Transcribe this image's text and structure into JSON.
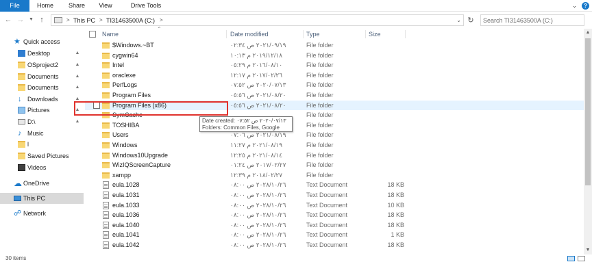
{
  "ribbon": {
    "tabs": [
      {
        "label": "File"
      },
      {
        "label": "Home"
      },
      {
        "label": "Share"
      },
      {
        "label": "View"
      },
      {
        "label": "Drive Tools"
      }
    ],
    "help_label": "?"
  },
  "address": {
    "segments": [
      "This PC",
      "TI31463500A (C:)"
    ],
    "separator": ">"
  },
  "search": {
    "placeholder": "Search TI31463500A (C:)"
  },
  "nav": {
    "items": [
      {
        "label": "Quick access",
        "icon": "star-icon",
        "pinned": false
      },
      {
        "label": "Desktop",
        "icon": "desktop-folder-icon",
        "pinned": true
      },
      {
        "label": "OSproject2",
        "icon": "folder-icon",
        "pinned": true
      },
      {
        "label": "Documents",
        "icon": "documents-folder-icon",
        "pinned": true
      },
      {
        "label": "Documents",
        "icon": "folder-icon",
        "pinned": true
      },
      {
        "label": "Downloads",
        "icon": "download-icon",
        "pinned": true
      },
      {
        "label": "Pictures",
        "icon": "pictures-folder-icon",
        "pinned": true
      },
      {
        "label": "D:\\",
        "icon": "drive-icon",
        "pinned": true
      },
      {
        "label": "Music",
        "icon": "music-icon",
        "pinned": false
      },
      {
        "label": "l",
        "icon": "folder-icon",
        "pinned": false
      },
      {
        "label": "Saved Pictures",
        "icon": "folder-icon",
        "pinned": false
      },
      {
        "label": "Videos",
        "icon": "videos-folder-icon",
        "pinned": false
      },
      {
        "label": "OneDrive",
        "icon": "cloud-icon",
        "pinned": false
      },
      {
        "label": "This PC",
        "icon": "computer-icon",
        "pinned": false,
        "selected": true
      },
      {
        "label": "Network",
        "icon": "network-icon",
        "pinned": false
      }
    ]
  },
  "columns": {
    "name": "Name",
    "date": "Date modified",
    "type": "Type",
    "size": "Size"
  },
  "files": [
    {
      "name": "$Windows.~BT",
      "date": "٢٠٢١/٠٩/١٩ ص ٠٢:٣٤",
      "type": "File folder",
      "size": "",
      "kind": "folder"
    },
    {
      "name": "cygwin64",
      "date": "٢٠١٩/١٢/١٨ م ١٠:١٣",
      "type": "File folder",
      "size": "",
      "kind": "folder"
    },
    {
      "name": "Intel",
      "date": "٢٠١٦/٠٨/١٠ م ٠٥:٢٩",
      "type": "File folder",
      "size": "",
      "kind": "folder"
    },
    {
      "name": "oraclexe",
      "date": "٢٠١٧/٠٢/٢٦ م ١٢:١٧",
      "type": "File folder",
      "size": "",
      "kind": "folder"
    },
    {
      "name": "PerfLogs",
      "date": "٢٠٢٠/٠٧/١٣ ص ٠٧:٥٢",
      "type": "File folder",
      "size": "",
      "kind": "folder"
    },
    {
      "name": "Program Files",
      "date": "٢٠٢١/٠٨/٢٠ ص ٠٥:٥٦",
      "type": "File folder",
      "size": "",
      "kind": "folder"
    },
    {
      "name": "Program Files (x86)",
      "date": "٢٠٢١/٠٨/٢٠ ص ٠٥:٥٦",
      "type": "File folder",
      "size": "",
      "kind": "folder",
      "hover": true
    },
    {
      "name": "SymCache",
      "date": "",
      "type": "File folder",
      "size": "",
      "kind": "folder"
    },
    {
      "name": "TOSHIBA",
      "date": "",
      "type": "File folder",
      "size": "",
      "kind": "folder"
    },
    {
      "name": "Users",
      "date": "٢٠٢١/٠٨/١٩ ص ٠٧:٠٦",
      "type": "File folder",
      "size": "",
      "kind": "folder"
    },
    {
      "name": "Windows",
      "date": "٢٠٢١/٠٨/١٩ م ١١:٢٧",
      "type": "File folder",
      "size": "",
      "kind": "folder"
    },
    {
      "name": "Windows10Upgrade",
      "date": "٢٠٢١/٠٨/١٤ م ١٢:٢٥",
      "type": "File folder",
      "size": "",
      "kind": "folder"
    },
    {
      "name": "WizIQScreenCapture",
      "date": "٢٠١٧/٠٢/٢٧ ص ٠١:٢٤",
      "type": "File folder",
      "size": "",
      "kind": "folder"
    },
    {
      "name": "xampp",
      "date": "٢٠١٨/٠٢/٢٧ م ١٢:٣٩",
      "type": "File folder",
      "size": "",
      "kind": "folder"
    },
    {
      "name": "eula.1028",
      "date": "٢٠٢٨/١٠/٢٦ ص ٠٨:٠٠",
      "type": "Text Document",
      "size": "18 KB",
      "kind": "doc"
    },
    {
      "name": "eula.1031",
      "date": "٢٠٢٨/١٠/٢٦ ص ٠٨:٠٠",
      "type": "Text Document",
      "size": "18 KB",
      "kind": "doc"
    },
    {
      "name": "eula.1033",
      "date": "٢٠٢٨/١٠/٢٦ ص ٠٨:٠٠",
      "type": "Text Document",
      "size": "10 KB",
      "kind": "doc"
    },
    {
      "name": "eula.1036",
      "date": "٢٠٢٨/١٠/٢٦ ص ٠٨:٠٠",
      "type": "Text Document",
      "size": "18 KB",
      "kind": "doc"
    },
    {
      "name": "eula.1040",
      "date": "٢٠٢٨/١٠/٢٦ ص ٠٨:٠٠",
      "type": "Text Document",
      "size": "18 KB",
      "kind": "doc"
    },
    {
      "name": "eula.1041",
      "date": "٢٠٢٨/١٠/٢٦ ص ٠٨:٠٠",
      "type": "Text Document",
      "size": "1 KB",
      "kind": "doc"
    },
    {
      "name": "eula.1042",
      "date": "٢٠٢٨/١٠/٢٦ ص ٠٨:٠٠",
      "type": "Text Document",
      "size": "18 KB",
      "kind": "doc"
    }
  ],
  "tooltip": {
    "line1": "Date created: ٢٠٢٠/٠٧/١٣ ص ٠٧:٥٢",
    "line2": "Folders: Common Files, Google"
  },
  "status": {
    "items": "30 items"
  },
  "colors": {
    "accent": "#1979ca",
    "highlight_border": "#e0322c",
    "folder": "#f8d775"
  }
}
